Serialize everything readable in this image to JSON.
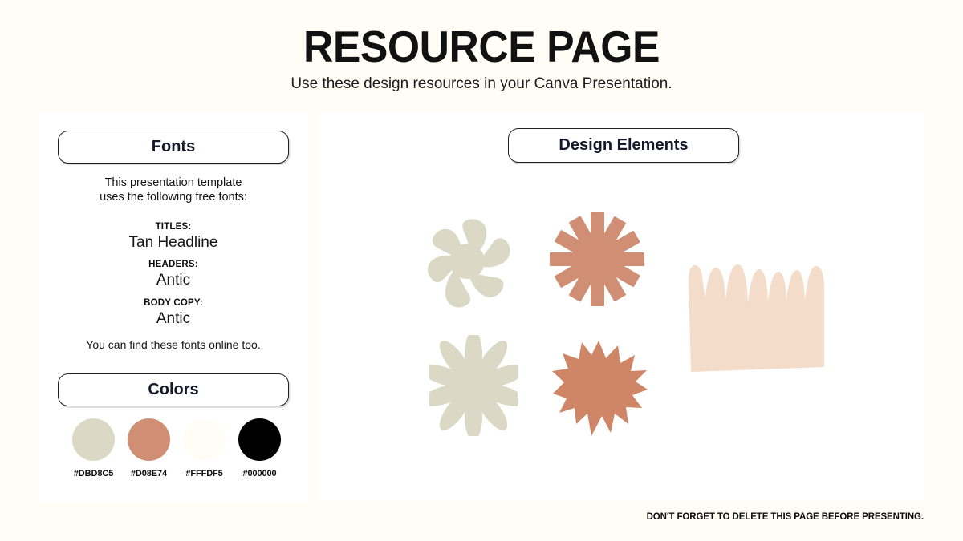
{
  "page": {
    "background_color": "#FFFDF5",
    "title": "RESOURCE PAGE",
    "subtitle": "Use these design resources in your Canva Presentation.",
    "footer_note": "DON'T FORGET TO DELETE THIS PAGE BEFORE PRESENTING."
  },
  "fonts_panel": {
    "heading": "Fonts",
    "intro_line_1": "This presentation template",
    "intro_line_2": "uses the following free fonts:",
    "groups": [
      {
        "role": "TITLES:",
        "name": "Tan Headline"
      },
      {
        "role": "HEADERS:",
        "name": "Antic"
      },
      {
        "role": "BODY COPY:",
        "name": "Antic"
      }
    ],
    "note": "You can find these fonts online too."
  },
  "colors_panel": {
    "heading": "Colors",
    "swatches": [
      {
        "hex": "#DBD8C5",
        "label": "#DBD8C5"
      },
      {
        "hex": "#D08E74",
        "label": "#D08E74"
      },
      {
        "hex": "#FFFDF5",
        "label": "#FFFDF5"
      },
      {
        "hex": "#000000",
        "label": "#000000"
      }
    ]
  },
  "design_elements_panel": {
    "heading": "Design Elements",
    "shapes": [
      {
        "name": "six-petal-flower",
        "color": "#DBD8C5"
      },
      {
        "name": "ray-starburst",
        "color": "#D08E74"
      },
      {
        "name": "daisy-flower",
        "color": "#DBD8C5"
      },
      {
        "name": "spiky-star",
        "color": "#CE8667"
      },
      {
        "name": "grass-block",
        "color": "#F4DCCA"
      }
    ]
  }
}
